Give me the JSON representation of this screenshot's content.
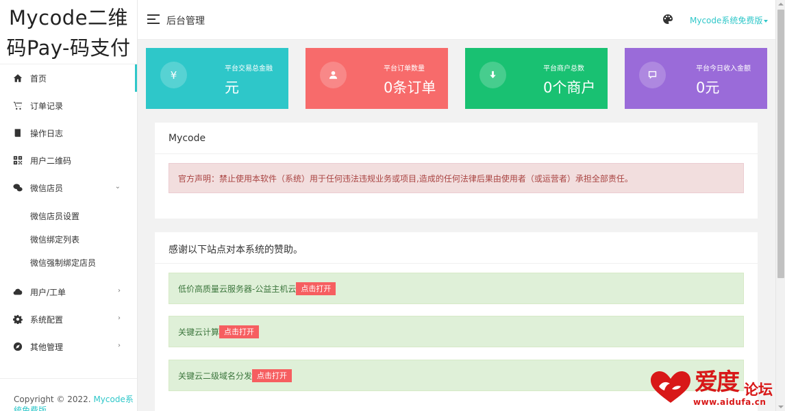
{
  "brand": {
    "line1": "Mycode二维",
    "line2": "码Pay-码支付"
  },
  "sidebar": {
    "items": [
      {
        "label": "首页",
        "icon": "home-icon"
      },
      {
        "label": "订单记录",
        "icon": "cart-icon"
      },
      {
        "label": "操作日志",
        "icon": "book-icon"
      },
      {
        "label": "用户二维码",
        "icon": "qrcode-icon"
      },
      {
        "label": "微信店员",
        "icon": "wechat-icon",
        "chevron": "⌄"
      },
      {
        "label": "用户/工单",
        "icon": "cloud-icon",
        "chevron": "›"
      },
      {
        "label": "系统配置",
        "icon": "gear-icon",
        "chevron": "›"
      },
      {
        "label": "其他管理",
        "icon": "compass-icon",
        "chevron": "›"
      }
    ],
    "submenu": [
      "微信店员设置",
      "微信绑定列表",
      "微信强制绑定店员"
    ]
  },
  "footer": {
    "text": "Copyright © 2022. ",
    "link": "Mycode系统免费版"
  },
  "topbar": {
    "title": "后台管理",
    "user_menu": "Mycode系统免费版"
  },
  "stats": [
    {
      "label": "平台交易总金融",
      "value": "元",
      "icon": "yen-icon",
      "color": "#2ec7c9"
    },
    {
      "label": "平台订单数量",
      "value": "0条订单",
      "icon": "user-icon",
      "color": "#f76b6b"
    },
    {
      "label": "平台商户总数",
      "value": "0个商户",
      "icon": "download-icon",
      "color": "#19c172"
    },
    {
      "label": "平台今日收入金额",
      "value": "0元",
      "icon": "message-icon",
      "color": "#9a6bd9"
    }
  ],
  "notice_panel": {
    "title": "Mycode",
    "alert": "官方声明：禁止使用本软件（系统）用于任何违法违规业务或项目,造成的任何法律后果由使用者（或运营者）承担全部责任。"
  },
  "sponsor_panel": {
    "title": "感谢以下站点对本系统的赞助。",
    "items": [
      {
        "text": "低价高质量云服务器-公益主机云",
        "button": "点击打开"
      },
      {
        "text": "关键云计算",
        "button": "点击打开"
      },
      {
        "text": "关键云二级域名分发",
        "button": "点击打开"
      }
    ]
  },
  "watermark": {
    "big": "爱度",
    "small": "论坛",
    "url": "www.aidufa.cn"
  },
  "colors": {
    "accent": "#2ec7c9",
    "danger_button": "#f65e60",
    "watermark": "#d81818"
  }
}
